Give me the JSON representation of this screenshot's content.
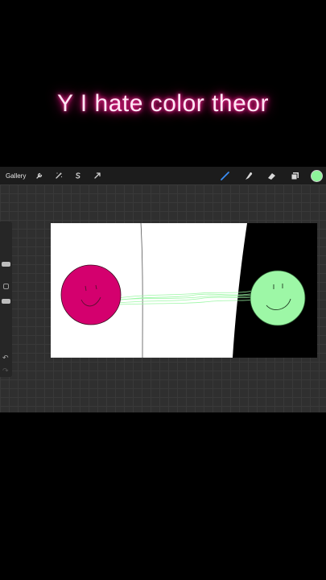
{
  "caption": "Y I hate color theor",
  "toolbar": {
    "gallery_label": "Gallery",
    "left_icons": [
      "wrench-icon",
      "magic-wand-icon",
      "selection-s-icon",
      "transform-arrow-icon"
    ],
    "right_icons": [
      "brush-icon",
      "smudge-icon",
      "eraser-icon",
      "layers-icon"
    ],
    "active_color": "#8df59a"
  },
  "sidebar": {
    "icons": [
      "brush-size-slider",
      "modify-button",
      "opacity-slider",
      "undo-icon",
      "redo-icon"
    ]
  },
  "canvas": {
    "colors": {
      "background": "#ffffff",
      "dark_panel": "#000000",
      "magenta": "#d4006e",
      "green": "#9df7a6",
      "line": "#555555"
    }
  }
}
